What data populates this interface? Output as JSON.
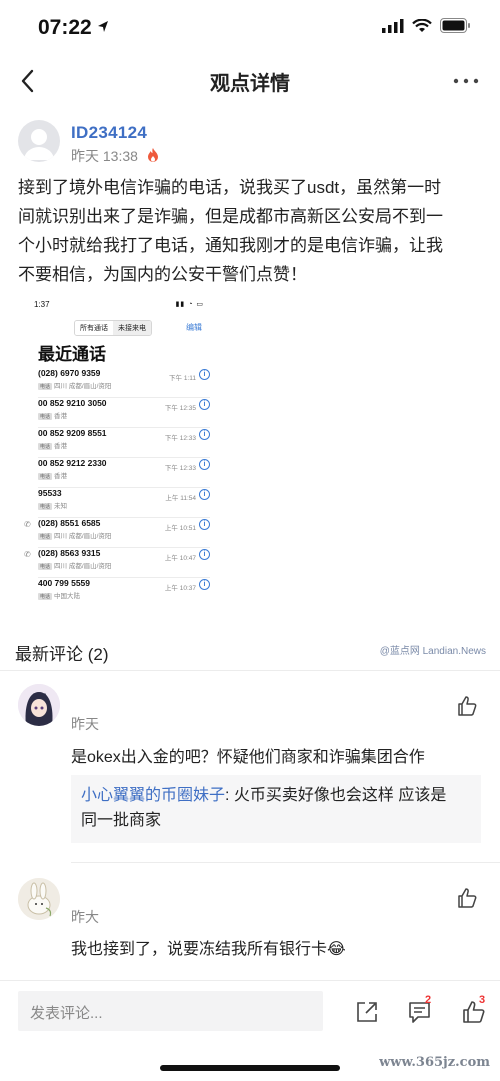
{
  "status_bar": {
    "time": "07:22"
  },
  "nav": {
    "title": "观点详情"
  },
  "author": {
    "id": "ID234124",
    "time": "昨天 13:38"
  },
  "post": {
    "lines": [
      "接到了境外电信诈骗的电话，说我买了usdt，虽然第一时",
      "间就识别出来了是诈骗，但是成都市高新区公安局不到一",
      "个小时就给我打了电话，通知我刚才的是电信诈骗，让我",
      "不要相信，为国内的公安干警们点赞！"
    ]
  },
  "screenshot": {
    "time": "1:37",
    "tab_all": "所有通话",
    "tab_missed": "未接来电",
    "edit": "编辑",
    "title": "最近通话",
    "calls": [
      {
        "number": "(028) 6970 9359",
        "tag": "电话",
        "location": "四川 成都/眉山/资阳",
        "time": "下午 1:11"
      },
      {
        "number": "00 852 9210 3050",
        "tag": "电话",
        "location": "香港",
        "time": "下午 12:35"
      },
      {
        "number": "00 852 9209 8551",
        "tag": "电话",
        "location": "香港",
        "time": "下午 12:33"
      },
      {
        "number": "00 852 9212 2330",
        "tag": "电话",
        "location": "香港",
        "time": "下午 12:33"
      },
      {
        "number": "95533",
        "tag": "电话",
        "location": "未知",
        "time": "上午 11:54"
      },
      {
        "number": "(028) 8551 6585",
        "tag": "电话",
        "location": "四川 成都/眉山/资阳",
        "time": "上午 10:51"
      },
      {
        "number": "(028) 8563 9315",
        "tag": "电话",
        "location": "四川 成都/眉山/资阳",
        "time": "上午 10:47"
      },
      {
        "number": "400 799 5559",
        "tag": "电话",
        "location": "中国大陆",
        "time": "上午 10:37"
      }
    ],
    "watermark": "@蓝点网 Landian.News"
  },
  "comments": {
    "heading": "最新评论 (2)",
    "items": [
      {
        "time": "昨天",
        "text": "是okex出入金的吧？怀疑他们商家和诈骗集团合作"
      },
      {
        "time": "昨大",
        "text": "我也接到了，说要冻结我所有银行卡😂"
      }
    ],
    "reply": {
      "name": "小心翼翼的币圈妹子",
      "line1": ": 火币买卖好像也会这样 应该是",
      "line2": "同一批商家"
    }
  },
  "bottom_bar": {
    "input_placeholder": "发表评论...",
    "comment_count": "2",
    "like_count": "3"
  },
  "site_watermark": "www.365jz.com"
}
